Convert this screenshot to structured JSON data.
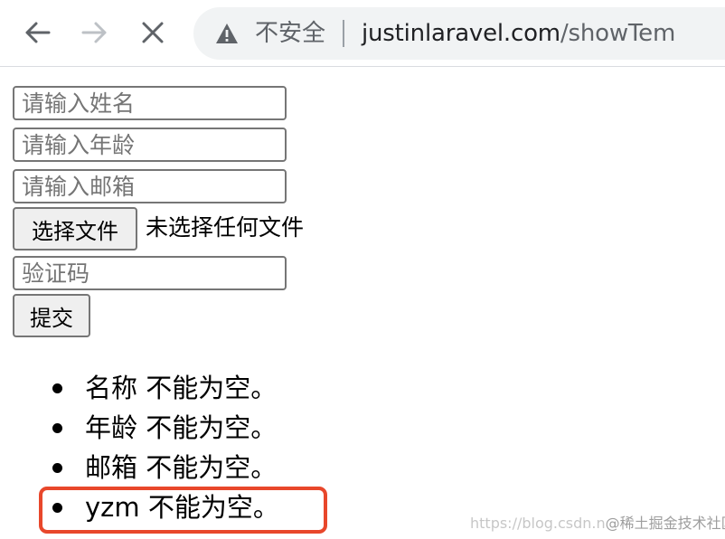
{
  "browser": {
    "security_label": "不安全",
    "url_host": "justinlaravel.com",
    "url_path": "/showTem",
    "icons": {
      "back": "back-arrow-icon",
      "forward": "forward-arrow-icon",
      "stop": "close-icon",
      "security": "warning-icon"
    }
  },
  "form": {
    "name_placeholder": "请输入姓名",
    "age_placeholder": "请输入年龄",
    "email_placeholder": "请输入邮箱",
    "choose_file_label": "选择文件",
    "file_status": "未选择任何文件",
    "captcha_placeholder": "验证码",
    "submit_label": "提交"
  },
  "errors": [
    "名称 不能为空。",
    "年龄 不能为空。",
    "邮箱 不能为空。",
    "yzm 不能为空。"
  ],
  "watermark": {
    "url": "https://blog.csdn.n",
    "brand": "@稀土掘金技术社区"
  },
  "colors": {
    "highlight": "#e8472b",
    "omnibox_bg": "#f1f3f4"
  }
}
